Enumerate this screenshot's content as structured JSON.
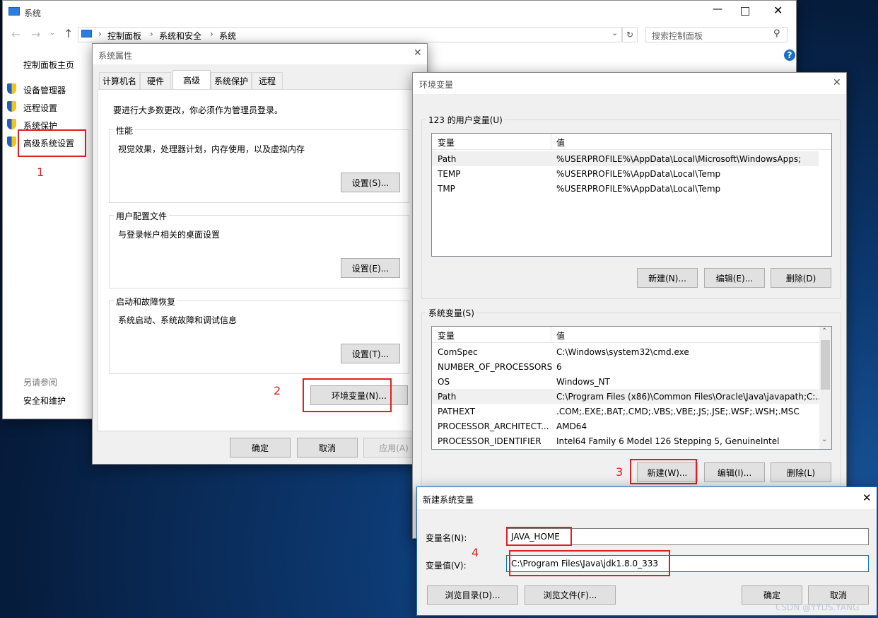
{
  "system_window": {
    "title": "系统",
    "breadcrumb": [
      "控制面板",
      "系统和安全",
      "系统"
    ],
    "search_placeholder": "搜索控制面板",
    "sidebar_home": "控制面板主页",
    "sidebar_items": [
      "设备管理器",
      "远程设置",
      "系统保护",
      "高级系统设置"
    ],
    "see_also_title": "另请参阅",
    "see_also_item": "安全和维护"
  },
  "sys_props": {
    "title": "系统属性",
    "tabs": [
      "计算机名",
      "硬件",
      "高级",
      "系统保护",
      "远程"
    ],
    "admin_note": "要进行大多数更改，你必须作为管理员登录。",
    "performance": {
      "title": "性能",
      "desc": "视觉效果，处理器计划，内存使用，以及虚拟内存",
      "button": "设置(S)..."
    },
    "profile": {
      "title": "用户配置文件",
      "desc": "与登录帐户相关的桌面设置",
      "button": "设置(E)..."
    },
    "startup": {
      "title": "启动和故障恢复",
      "desc": "系统启动、系统故障和调试信息",
      "button": "设置(T)..."
    },
    "env_button": "环境变量(N)...",
    "ok": "确定",
    "cancel": "取消",
    "apply": "应用(A)"
  },
  "env_vars": {
    "title": "环境变量",
    "user_group_title": "123 的用户变量(U)",
    "col_var": "变量",
    "col_val": "值",
    "user_vars": [
      {
        "name": "Path",
        "value": "%USERPROFILE%\\AppData\\Local\\Microsoft\\WindowsApps;"
      },
      {
        "name": "TEMP",
        "value": "%USERPROFILE%\\AppData\\Local\\Temp"
      },
      {
        "name": "TMP",
        "value": "%USERPROFILE%\\AppData\\Local\\Temp"
      }
    ],
    "user_buttons": {
      "new": "新建(N)...",
      "edit": "编辑(E)...",
      "delete": "删除(D)"
    },
    "sys_group_title": "系统变量(S)",
    "sys_vars": [
      {
        "name": "ComSpec",
        "value": "C:\\Windows\\system32\\cmd.exe"
      },
      {
        "name": "NUMBER_OF_PROCESSORS",
        "value": "6"
      },
      {
        "name": "OS",
        "value": "Windows_NT"
      },
      {
        "name": "Path",
        "value": "C:\\Program Files (x86)\\Common Files\\Oracle\\Java\\javapath;C:..."
      },
      {
        "name": "PATHEXT",
        "value": ".COM;.EXE;.BAT;.CMD;.VBS;.VBE;.JS;.JSE;.WSF;.WSH;.MSC"
      },
      {
        "name": "PROCESSOR_ARCHITECT...",
        "value": "AMD64"
      },
      {
        "name": "PROCESSOR_IDENTIFIER",
        "value": "Intel64 Family 6 Model 126 Stepping 5, GenuineIntel"
      }
    ],
    "sys_buttons": {
      "new": "新建(W)...",
      "edit": "编辑(I)...",
      "delete": "删除(L)"
    }
  },
  "new_var": {
    "title": "新建系统变量",
    "name_label": "变量名(N):",
    "name_value": "JAVA_HOME",
    "value_label": "变量值(V):",
    "value_value": "C:\\Program Files\\Java\\jdk1.8.0_333",
    "browse_dir": "浏览目录(D)...",
    "browse_file": "浏览文件(F)...",
    "ok": "确定",
    "cancel": "取消"
  },
  "annotations": {
    "step1": "1",
    "step2": "2",
    "step3": "3",
    "step4": "4",
    "color": "#e02020"
  },
  "watermark": "CSDN @YYDS.YANG"
}
